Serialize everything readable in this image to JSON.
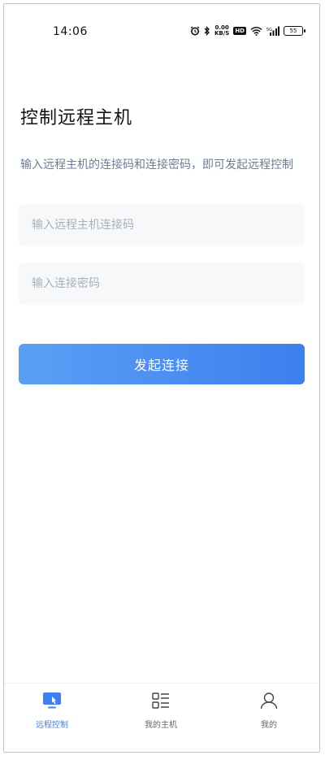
{
  "status_bar": {
    "time": "14:06",
    "net_speed_value": "0.00",
    "net_speed_unit": "KB/S",
    "hd_badge": "HD",
    "battery": "55"
  },
  "page": {
    "title": "控制远程主机",
    "description": "输入远程主机的连接码和连接密码，即可发起远程控制"
  },
  "form": {
    "code_placeholder": "输入远程主机连接码",
    "password_placeholder": "输入连接密码",
    "connect_label": "发起连接"
  },
  "tabs": [
    {
      "label": "远程控制",
      "icon": "remote-control-icon",
      "active": true
    },
    {
      "label": "我的主机",
      "icon": "host-list-icon",
      "active": false
    },
    {
      "label": "我的",
      "icon": "user-icon",
      "active": false
    }
  ],
  "colors": {
    "accent": "#3d80ee",
    "description_text": "#6b7d95",
    "input_bg": "#f7f8fa"
  }
}
